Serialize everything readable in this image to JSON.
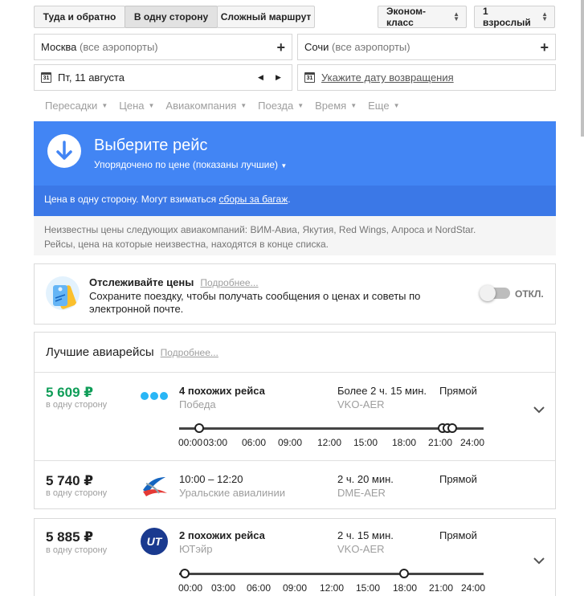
{
  "trip_types": [
    "Туда и обратно",
    "В одну сторону",
    "Сложный маршрут"
  ],
  "cabin_class": "Эконом-класс",
  "passengers": "1 взрослый",
  "origin": {
    "main": "Москва",
    "suffix": "(все аэропорты)"
  },
  "destination": {
    "main": "Сочи",
    "suffix": "(все аэропорты)"
  },
  "depart_date": "Пт, 11 августа",
  "return_date_placeholder": "Укажите дату возвращения",
  "calendar_day": "31",
  "filters": [
    "Пересадки",
    "Цена",
    "Авиакомпания",
    "Поезда",
    "Время",
    "Еще"
  ],
  "banner": {
    "title": "Выберите рейс",
    "sort": "Упорядочено по цене (показаны лучшие)",
    "note_prefix": "Цена в одну сторону. Могут взиматься ",
    "note_link": "сборы за багаж",
    "note_suffix": "."
  },
  "notice": {
    "line1": "Неизвестны цены следующих авиакомпаний: ВИМ-Авиа, Якутия, Red Wings, Алроса и NordStar.",
    "line2": "Рейсы, цена на которые неизвестна, находятся в конце списка."
  },
  "tracking": {
    "title": "Отслеживайте цены",
    "more": "Подробнее...",
    "desc": "Сохраните поездку, чтобы получать сообщения о ценах и советы по электронной почте.",
    "toggle_label": "ОТКЛ."
  },
  "best": {
    "title": "Лучшие авиарейсы",
    "more": "Подробнее..."
  },
  "flights": [
    {
      "price": "5 609 ₽",
      "price_note": "в одну сторону",
      "title": "4 похожих рейса",
      "airline": "Победа",
      "duration": "Более 2 ч. 15 мин.",
      "route": "VKO-AER",
      "stops": "Прямой",
      "timeline_labels": [
        "00:00",
        "03:00",
        "06:00",
        "09:00",
        "12:00",
        "15:00",
        "18:00",
        "21:00",
        "24:00"
      ]
    },
    {
      "price": "5 740 ₽",
      "price_note": "в одну сторону",
      "title": "10:00 – 12:20",
      "airline": "Уральские авиалинии",
      "duration": "2 ч. 20 мин.",
      "route": "DME-AER",
      "stops": "Прямой"
    },
    {
      "price": "5 885 ₽",
      "price_note": "в одну сторону",
      "title": "2 похожих рейса",
      "airline": "ЮТэйр",
      "duration": "2 ч. 15 мин.",
      "route": "VKO-AER",
      "stops": "Прямой",
      "timeline_labels": [
        "00:00",
        "03:00",
        "06:00",
        "09:00",
        "12:00",
        "15:00",
        "18:00",
        "21:00",
        "24:00"
      ]
    }
  ],
  "colors": {
    "accent": "#4285f4",
    "green_price": "#0f9d58",
    "pobeda_blue": "#29b6f6",
    "utair_blue": "#1a3a8f"
  }
}
